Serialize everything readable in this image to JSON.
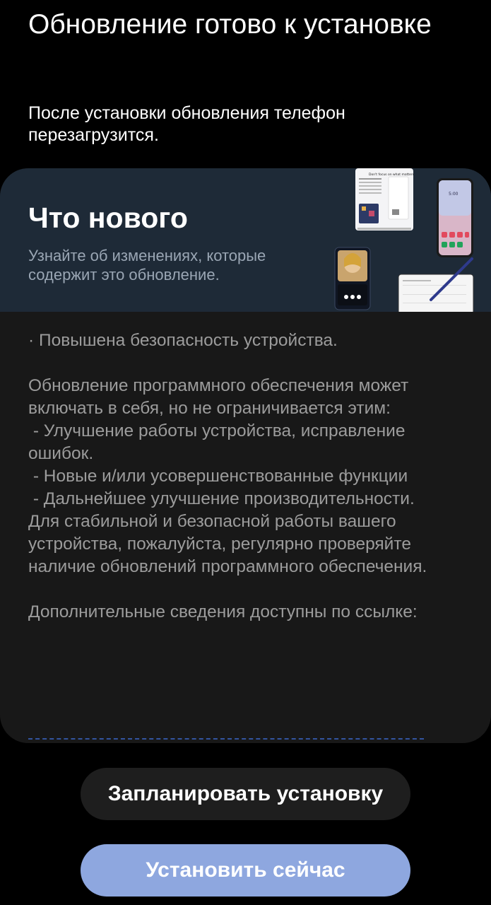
{
  "header": {
    "title": "Обновление готово к установке",
    "subtitle": "После установки обновления телефон перезагрузится."
  },
  "whats_new": {
    "title": "Что нового",
    "description": "Узнайте об изменениях, которые содержит это обновление.",
    "illustration": "devices-illustration",
    "device_texts": {
      "screen_caption": "Don't focus on what matters",
      "clock": "5:00"
    }
  },
  "release_notes": "· Повышена безопасность устройства.\n\nОбновление программного обеспечения может включать в себя, но не ограничивается этим:\n - Улучшение работы устройства, исправление ошибок.\n - Новые и/или усовершенствованные функции\n - Дальнейшее улучшение производительности.\nДля стабильной и безопасной работы вашего устройства, пожалуйста, регулярно проверяйте наличие обновлений программного обеспечения.\n\nДополнительные сведения доступны по ссылке:",
  "buttons": {
    "schedule_label": "Запланировать установку",
    "install_label": "Установить сейчас"
  },
  "colors": {
    "background": "#000000",
    "banner": "#1e2a37",
    "card": "#181818",
    "primary_button": "#8ea7df",
    "secondary_button": "#1e1e1e"
  }
}
